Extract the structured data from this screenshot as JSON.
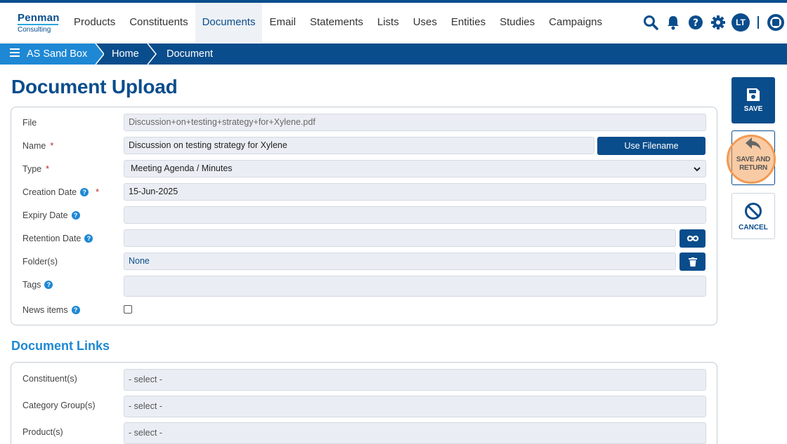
{
  "logo": {
    "line1": "Penman",
    "line2": "Consulting"
  },
  "nav": {
    "items": [
      {
        "label": "Products",
        "active": false
      },
      {
        "label": "Constituents",
        "active": false
      },
      {
        "label": "Documents",
        "active": true
      },
      {
        "label": "Email",
        "active": false
      },
      {
        "label": "Statements",
        "active": false
      },
      {
        "label": "Lists",
        "active": false
      },
      {
        "label": "Uses",
        "active": false
      },
      {
        "label": "Entities",
        "active": false
      },
      {
        "label": "Studies",
        "active": false
      },
      {
        "label": "Campaigns",
        "active": false
      }
    ],
    "icons": [
      "search-icon",
      "bell-icon",
      "help-icon",
      "gear-icon"
    ],
    "avatar": "LT"
  },
  "breadcrumb": {
    "root": "AS Sand Box",
    "items": [
      "Home",
      "Document"
    ]
  },
  "page": {
    "title": "Document Upload",
    "links_title": "Document Links"
  },
  "form": {
    "file": {
      "label": "File",
      "value": "Discussion+on+testing+strategy+for+Xylene.pdf"
    },
    "name": {
      "label": "Name",
      "value": "Discussion on testing strategy for Xylene",
      "button": "Use Filename"
    },
    "type": {
      "label": "Type",
      "value": "Meeting Agenda / Minutes"
    },
    "creation_date": {
      "label": "Creation Date",
      "value": "15-Jun-2025"
    },
    "expiry_date": {
      "label": "Expiry Date",
      "value": ""
    },
    "retention_date": {
      "label": "Retention Date",
      "value": ""
    },
    "folders": {
      "label": "Folder(s)",
      "value": "None"
    },
    "tags": {
      "label": "Tags",
      "value": ""
    },
    "news_items": {
      "label": "News items",
      "checked": false
    },
    "required_mark": "*"
  },
  "links": {
    "constituents": {
      "label": "Constituent(s)",
      "placeholder": "- select -"
    },
    "category_groups": {
      "label": "Category Group(s)",
      "placeholder": "- select -"
    },
    "products": {
      "label": "Product(s)",
      "placeholder": "- select -"
    }
  },
  "actions": {
    "save": "SAVE",
    "save_and_return": [
      "SAVE AND",
      "RETURN"
    ],
    "cancel": "CANCEL"
  },
  "colors": {
    "primary": "#0a4d8c",
    "accent": "#1e88d4",
    "required": "#c0262d",
    "highlight": "#f29a55"
  }
}
